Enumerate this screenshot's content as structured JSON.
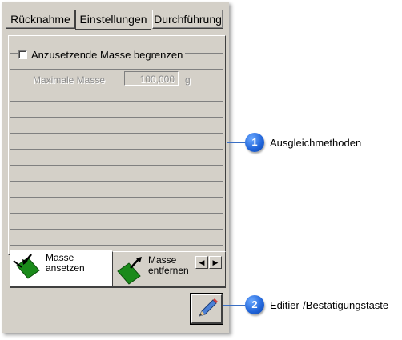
{
  "tabs": [
    {
      "label": "Rücknahme",
      "active": false
    },
    {
      "label": "Einstellungen",
      "active": true
    },
    {
      "label": "Durchführung",
      "active": false
    }
  ],
  "settings": {
    "limit_checkbox_label": "Anzusetzende Masse begrenzen",
    "limit_checked": false,
    "max_mass_label": "Maximale Masse",
    "max_mass_value": "100,000",
    "max_mass_unit": "g"
  },
  "bottom_tabs": [
    {
      "label_line1": "Masse",
      "label_line2": "ansetzen",
      "icon": "mass-apply-icon",
      "active": true
    },
    {
      "label_line1": "Masse",
      "label_line2": "entfernen",
      "icon": "mass-remove-icon",
      "active": false
    }
  ],
  "scroll": {
    "left": "◀",
    "right": "▶"
  },
  "edit_button": {
    "icon": "pencil-icon"
  },
  "callouts": [
    {
      "number": "1",
      "text": "Ausgleichmethoden"
    },
    {
      "number": "2",
      "text": "Editier-/Bestätigungstaste"
    }
  ],
  "colors": {
    "panel": "#d4d0c8",
    "callout": "#1f63d8",
    "mass_green": "#1a8a1a"
  }
}
